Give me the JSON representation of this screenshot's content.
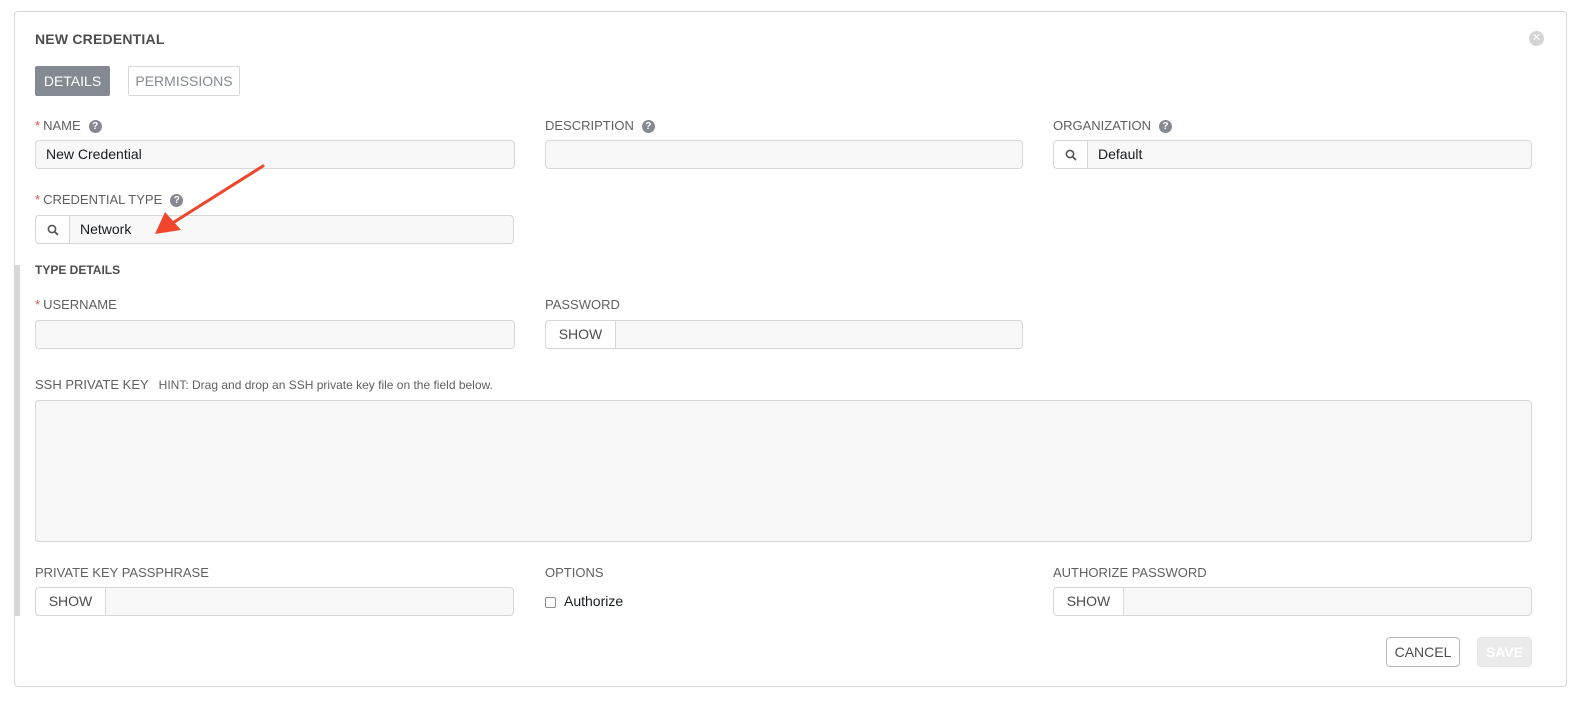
{
  "dialog": {
    "title": "NEW CREDENTIAL"
  },
  "tabs": [
    {
      "label": "DETAILS",
      "active": true
    },
    {
      "label": "PERMISSIONS",
      "active": false
    }
  ],
  "fields": {
    "name": {
      "label": "NAME",
      "value": "New Credential",
      "required": true
    },
    "description": {
      "label": "DESCRIPTION",
      "value": ""
    },
    "organization": {
      "label": "ORGANIZATION",
      "value": "Default"
    },
    "credential_type": {
      "label": "CREDENTIAL TYPE",
      "value": "Network",
      "required": true
    }
  },
  "type_details": {
    "title": "TYPE DETAILS",
    "username": {
      "label": "USERNAME",
      "value": "",
      "required": true
    },
    "password": {
      "label": "PASSWORD",
      "show_label": "SHOW"
    },
    "ssh_private_key": {
      "label": "SSH PRIVATE KEY",
      "hint": "HINT: Drag and drop an SSH private key file on the field below."
    },
    "private_key_passphrase": {
      "label": "PRIVATE KEY PASSPHRASE",
      "show_label": "SHOW"
    },
    "options": {
      "label": "OPTIONS",
      "authorize_label": "Authorize",
      "authorize_checked": false
    },
    "authorize_password": {
      "label": "AUTHORIZE PASSWORD",
      "show_label": "SHOW"
    }
  },
  "actions": {
    "cancel_label": "CANCEL",
    "save_label": "SAVE"
  },
  "required_marker": "*",
  "help_glyph": "?",
  "close_glyph": "✕",
  "colors": {
    "active_tab": "#848992",
    "required": "#d9534f",
    "annotation_arrow": "#f0462d"
  }
}
